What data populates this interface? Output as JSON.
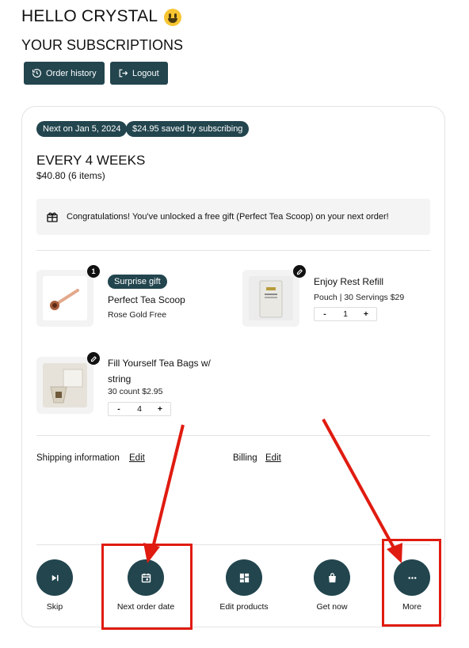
{
  "greeting": "HELLO CRYSTAL",
  "subscriptions_title": "YOUR SUBSCRIPTIONS",
  "top_buttons": {
    "order_history": "Order history",
    "logout": "Logout"
  },
  "subscription": {
    "next_badge": "Next on Jan 5, 2024",
    "saved_badge": "$24.95 saved by subscribing",
    "frequency": "EVERY 4 WEEKS",
    "price_summary": "$40.80 (6 items)",
    "gift_message": "Congratulations! You've unlocked a free gift (Perfect Tea Scoop) on your next order!",
    "products": [
      {
        "badge": "Surprise gift",
        "name": "Perfect Tea Scoop",
        "meta": "Rose Gold Free",
        "count_badge": "1"
      },
      {
        "name": "Enjoy Rest Refill",
        "meta": "Pouch | 30 Servings $29",
        "quantity": "1",
        "minus": "-",
        "plus": "+"
      },
      {
        "name": "Fill Yourself Tea Bags w/ string",
        "meta": "30 count $2.95",
        "quantity": "4",
        "minus": "-",
        "plus": "+"
      }
    ],
    "shipping_label": "Shipping information",
    "billing_label": "Billing",
    "edit_label": "Edit"
  },
  "actions": [
    {
      "label": "Skip",
      "icon": "skip-next-icon"
    },
    {
      "label": "Next order date",
      "icon": "calendar-icon"
    },
    {
      "label": "Edit products",
      "icon": "dashboard-grid-icon"
    },
    {
      "label": "Get now",
      "icon": "shopping-bag-icon"
    },
    {
      "label": "More",
      "icon": "more-dots-icon"
    }
  ],
  "colors": {
    "primary": "#22454e",
    "annotation_red": "#e01b10",
    "card_border": "#e3e3e3",
    "gift_bg": "#f4f4f4"
  }
}
